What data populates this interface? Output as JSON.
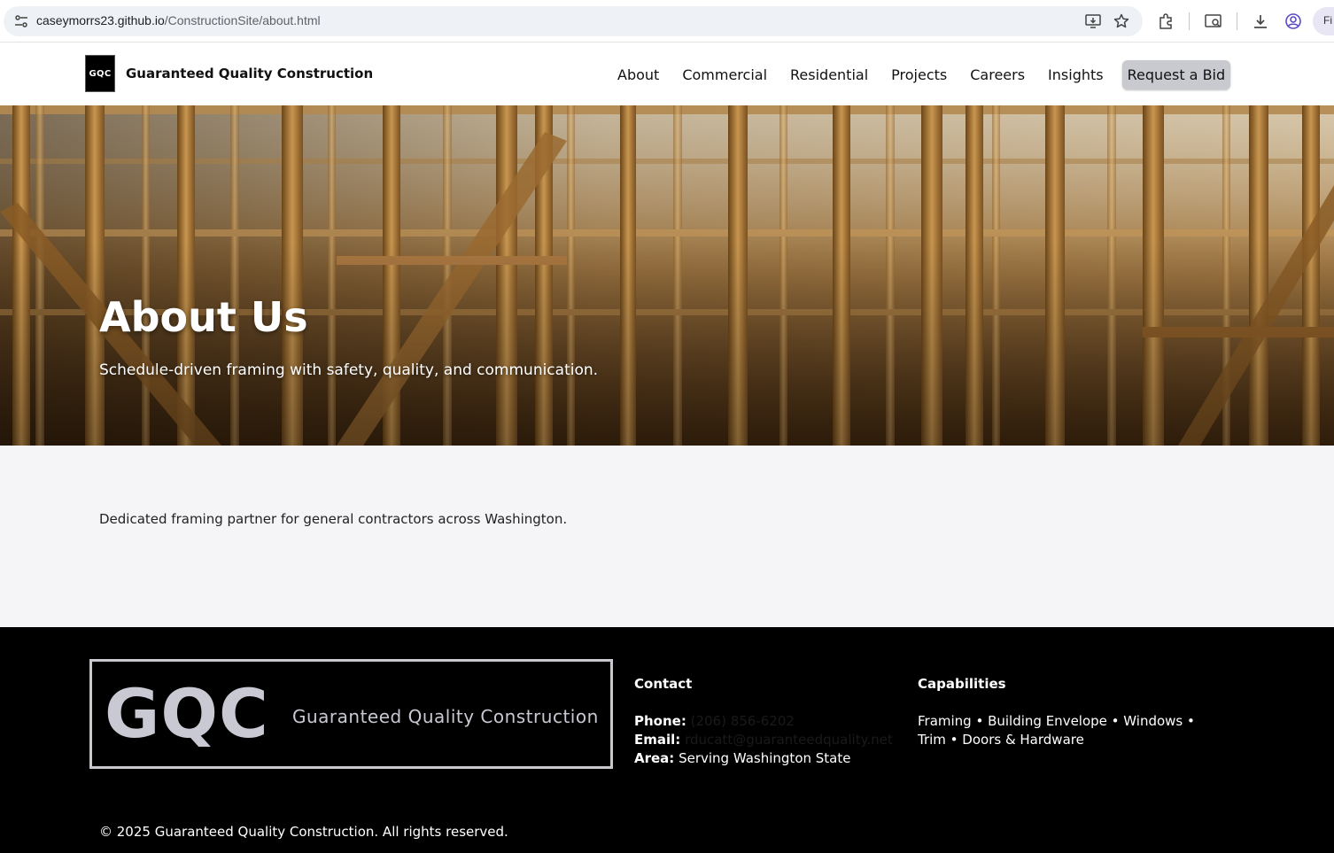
{
  "browser": {
    "url_host": "caseymorrs23.github.io",
    "url_path": "/ConstructionSite/about.html",
    "profile_label": "Fi",
    "icons": [
      "tune-icon",
      "install-icon",
      "star-icon",
      "extensions-icon",
      "tab-search-icon",
      "download-icon",
      "profile-icon"
    ]
  },
  "header": {
    "logo_text": "GQC",
    "brand": "Guaranteed Quality Construction",
    "nav": [
      "About",
      "Commercial",
      "Residential",
      "Projects",
      "Careers",
      "Insights"
    ],
    "cta": "Request a Bid"
  },
  "hero": {
    "title": "About Us",
    "subtitle": "Schedule-driven framing with safety, quality, and communication."
  },
  "main": {
    "intro": "Dedicated framing partner for general contractors across Washington."
  },
  "footer": {
    "logo_big": "GQC",
    "logo_small": "Guaranteed Quality Construction",
    "contact": {
      "heading": "Contact",
      "phone_label": "Phone:",
      "phone": "(206) 856-6202",
      "email_label": "Email:",
      "email": "rducatt@guaranteedquality.net",
      "area_label": "Area:",
      "area": "Serving Washington State"
    },
    "capabilities": {
      "heading": "Capabilities",
      "line1": "Framing • Building Envelope • Windows •",
      "line2": "Trim • Doors & Hardware"
    },
    "copyright": "© 2025 Guaranteed Quality Construction. All rights reserved."
  },
  "colors": {
    "footer_bg": "#000000",
    "cta_bg": "#c8cacf",
    "page_bg": "#f5f5f7",
    "hero_wood": "#a97d45"
  }
}
